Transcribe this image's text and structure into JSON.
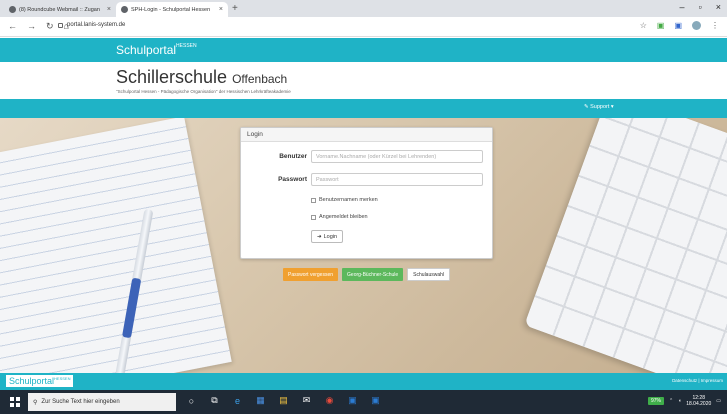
{
  "browser": {
    "tabs": [
      {
        "title": "(8) Roundcube Webmail :: Zugan",
        "active": false
      },
      {
        "title": "SPH-Login - Schulportal Hessen",
        "active": true
      }
    ],
    "new_tab": "+",
    "url": "portal.lanis-system.de",
    "window_controls": [
      "–",
      "▫",
      "×"
    ]
  },
  "site": {
    "brand": "Schulportal",
    "brand_sup": "HESSEN",
    "school_name": "Schillerschule",
    "school_city": "Offenbach",
    "tagline": "\"Schulportal Hessen - Pädagogische Organisation\" der Hessischen Lehrkräfteakademie",
    "support_label": "Support ▾"
  },
  "login": {
    "heading": "Login",
    "user_label": "Benutzer",
    "user_placeholder": "Vorname.Nachname (oder Kürzel bei Lehrenden)",
    "password_label": "Passwort",
    "password_placeholder": "Passwort",
    "remember_user": "Benutzernamen merken",
    "stay_logged_in": "Angemeldet bleiben",
    "login_button": "Login"
  },
  "buttons": {
    "forgot_password": "Passwort vergessen",
    "school_button": "Georg-Büchner-Schule",
    "school_select": "Schulauswahl"
  },
  "footer": {
    "brand": "Schulportal",
    "brand_sup": "HESSEN",
    "links": "Datenschutz | Impressum"
  },
  "taskbar": {
    "search_placeholder": "Zur Suche Text hier eingeben",
    "battery": "97%",
    "time": "12:28",
    "date": "18.04.2020"
  },
  "colors": {
    "accent": "#1fb3c6",
    "orange": "#f0a030",
    "green": "#5cb85c",
    "taskbar": "#1f2a36"
  }
}
